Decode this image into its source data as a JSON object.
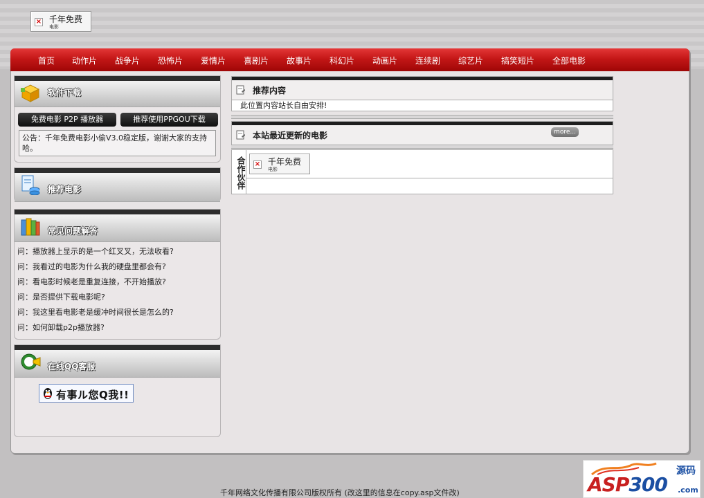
{
  "header_logo": {
    "line1": "千年免费",
    "line2": "电影"
  },
  "nav": {
    "items": [
      "首页",
      "动作片",
      "战争片",
      "恐怖片",
      "爱情片",
      "喜剧片",
      "故事片",
      "科幻片",
      "动画片",
      "连续剧",
      "综艺片",
      "搞笑短片",
      "全部电影"
    ]
  },
  "software": {
    "title": "软件下载",
    "btn_player": "免费电影 P2P 播放器",
    "btn_ppgou": "推荐使用PPGOU下载",
    "notice": "公告：千年免费电影小偷V3.0稳定版，谢谢大家的支持哈。"
  },
  "recommend_movies": {
    "title": "推荐电影"
  },
  "faq": {
    "title": "常见问题解答",
    "items": [
      "问：播放器上显示的是一个红叉叉，无法收看?",
      "问：我看过的电影为什么我的硬盘里都会有?",
      "问：看电影时候老是重复连接，不开始播放?",
      "问：是否提供下载电影呢?",
      "问：我这里看电影老是缓冲时间很长是怎么的?",
      "问：如何卸载p2p播放器?"
    ]
  },
  "qq_service": {
    "title": "在线QQ客服",
    "button_label": "有事ル您Q我!!"
  },
  "recommended_content": {
    "title": "推荐内容",
    "body": "此位置内容站长自由安排!"
  },
  "latest_movies": {
    "title": "本站最近更新的电影",
    "more": "more..."
  },
  "partners": {
    "side_label": "合作伙伴",
    "logo_line1": "千年免费",
    "logo_line2": "电影"
  },
  "footer": {
    "text": "千年网络文化传播有限公司版权所有 (改这里的信息在copy.asp文件改)"
  },
  "watermark": {
    "brand_a": "ASP",
    "brand_b": "300",
    "cn": "源码",
    "domain": ".com"
  }
}
